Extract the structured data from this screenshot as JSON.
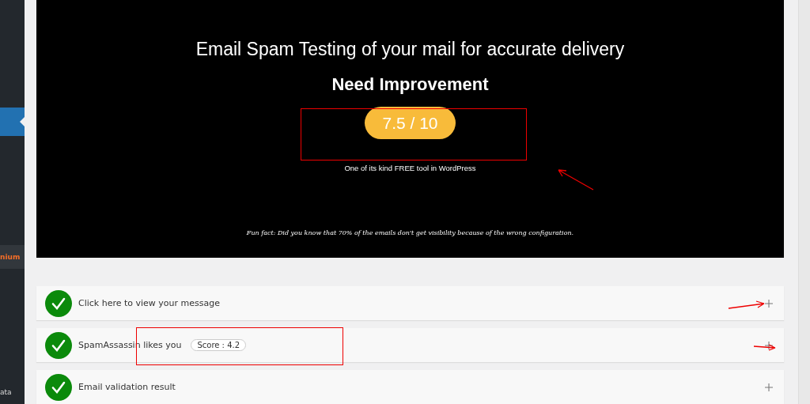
{
  "sidebar": {
    "items": [
      {
        "selected": true,
        "kind": "plain"
      },
      {
        "label": "nium",
        "selected": false,
        "kind": "highlight"
      },
      {
        "label": "ata",
        "selected": false,
        "kind": "plain"
      }
    ]
  },
  "hero": {
    "title": "Email Spam Testing of your mail for accurate delivery",
    "verdict": "Need Improvement",
    "score": "7.5 / 10",
    "tagline": "One of its kind FREE tool in WordPress",
    "fun_fact": "Fun fact: Did you know that 70% of the emails don't get visibility because of the wrong configuration."
  },
  "checks": [
    {
      "label": "Click here to view your message",
      "passed": true,
      "expanded": false
    },
    {
      "label": "SpamAssassin likes you",
      "badge": "Score : 4.2",
      "passed": true,
      "expanded": false
    },
    {
      "label": "Email validation result",
      "passed": true,
      "expanded": false
    }
  ]
}
